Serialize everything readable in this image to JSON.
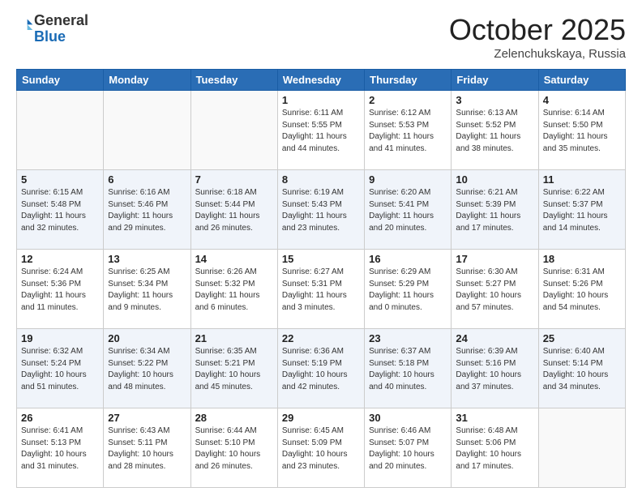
{
  "header": {
    "logo_general": "General",
    "logo_blue": "Blue",
    "month": "October 2025",
    "location": "Zelenchukskaya, Russia"
  },
  "weekdays": [
    "Sunday",
    "Monday",
    "Tuesday",
    "Wednesday",
    "Thursday",
    "Friday",
    "Saturday"
  ],
  "weeks": [
    [
      {
        "day": "",
        "info": ""
      },
      {
        "day": "",
        "info": ""
      },
      {
        "day": "",
        "info": ""
      },
      {
        "day": "1",
        "info": "Sunrise: 6:11 AM\nSunset: 5:55 PM\nDaylight: 11 hours\nand 44 minutes."
      },
      {
        "day": "2",
        "info": "Sunrise: 6:12 AM\nSunset: 5:53 PM\nDaylight: 11 hours\nand 41 minutes."
      },
      {
        "day": "3",
        "info": "Sunrise: 6:13 AM\nSunset: 5:52 PM\nDaylight: 11 hours\nand 38 minutes."
      },
      {
        "day": "4",
        "info": "Sunrise: 6:14 AM\nSunset: 5:50 PM\nDaylight: 11 hours\nand 35 minutes."
      }
    ],
    [
      {
        "day": "5",
        "info": "Sunrise: 6:15 AM\nSunset: 5:48 PM\nDaylight: 11 hours\nand 32 minutes."
      },
      {
        "day": "6",
        "info": "Sunrise: 6:16 AM\nSunset: 5:46 PM\nDaylight: 11 hours\nand 29 minutes."
      },
      {
        "day": "7",
        "info": "Sunrise: 6:18 AM\nSunset: 5:44 PM\nDaylight: 11 hours\nand 26 minutes."
      },
      {
        "day": "8",
        "info": "Sunrise: 6:19 AM\nSunset: 5:43 PM\nDaylight: 11 hours\nand 23 minutes."
      },
      {
        "day": "9",
        "info": "Sunrise: 6:20 AM\nSunset: 5:41 PM\nDaylight: 11 hours\nand 20 minutes."
      },
      {
        "day": "10",
        "info": "Sunrise: 6:21 AM\nSunset: 5:39 PM\nDaylight: 11 hours\nand 17 minutes."
      },
      {
        "day": "11",
        "info": "Sunrise: 6:22 AM\nSunset: 5:37 PM\nDaylight: 11 hours\nand 14 minutes."
      }
    ],
    [
      {
        "day": "12",
        "info": "Sunrise: 6:24 AM\nSunset: 5:36 PM\nDaylight: 11 hours\nand 11 minutes."
      },
      {
        "day": "13",
        "info": "Sunrise: 6:25 AM\nSunset: 5:34 PM\nDaylight: 11 hours\nand 9 minutes."
      },
      {
        "day": "14",
        "info": "Sunrise: 6:26 AM\nSunset: 5:32 PM\nDaylight: 11 hours\nand 6 minutes."
      },
      {
        "day": "15",
        "info": "Sunrise: 6:27 AM\nSunset: 5:31 PM\nDaylight: 11 hours\nand 3 minutes."
      },
      {
        "day": "16",
        "info": "Sunrise: 6:29 AM\nSunset: 5:29 PM\nDaylight: 11 hours\nand 0 minutes."
      },
      {
        "day": "17",
        "info": "Sunrise: 6:30 AM\nSunset: 5:27 PM\nDaylight: 10 hours\nand 57 minutes."
      },
      {
        "day": "18",
        "info": "Sunrise: 6:31 AM\nSunset: 5:26 PM\nDaylight: 10 hours\nand 54 minutes."
      }
    ],
    [
      {
        "day": "19",
        "info": "Sunrise: 6:32 AM\nSunset: 5:24 PM\nDaylight: 10 hours\nand 51 minutes."
      },
      {
        "day": "20",
        "info": "Sunrise: 6:34 AM\nSunset: 5:22 PM\nDaylight: 10 hours\nand 48 minutes."
      },
      {
        "day": "21",
        "info": "Sunrise: 6:35 AM\nSunset: 5:21 PM\nDaylight: 10 hours\nand 45 minutes."
      },
      {
        "day": "22",
        "info": "Sunrise: 6:36 AM\nSunset: 5:19 PM\nDaylight: 10 hours\nand 42 minutes."
      },
      {
        "day": "23",
        "info": "Sunrise: 6:37 AM\nSunset: 5:18 PM\nDaylight: 10 hours\nand 40 minutes."
      },
      {
        "day": "24",
        "info": "Sunrise: 6:39 AM\nSunset: 5:16 PM\nDaylight: 10 hours\nand 37 minutes."
      },
      {
        "day": "25",
        "info": "Sunrise: 6:40 AM\nSunset: 5:14 PM\nDaylight: 10 hours\nand 34 minutes."
      }
    ],
    [
      {
        "day": "26",
        "info": "Sunrise: 6:41 AM\nSunset: 5:13 PM\nDaylight: 10 hours\nand 31 minutes."
      },
      {
        "day": "27",
        "info": "Sunrise: 6:43 AM\nSunset: 5:11 PM\nDaylight: 10 hours\nand 28 minutes."
      },
      {
        "day": "28",
        "info": "Sunrise: 6:44 AM\nSunset: 5:10 PM\nDaylight: 10 hours\nand 26 minutes."
      },
      {
        "day": "29",
        "info": "Sunrise: 6:45 AM\nSunset: 5:09 PM\nDaylight: 10 hours\nand 23 minutes."
      },
      {
        "day": "30",
        "info": "Sunrise: 6:46 AM\nSunset: 5:07 PM\nDaylight: 10 hours\nand 20 minutes."
      },
      {
        "day": "31",
        "info": "Sunrise: 6:48 AM\nSunset: 5:06 PM\nDaylight: 10 hours\nand 17 minutes."
      },
      {
        "day": "",
        "info": ""
      }
    ]
  ]
}
